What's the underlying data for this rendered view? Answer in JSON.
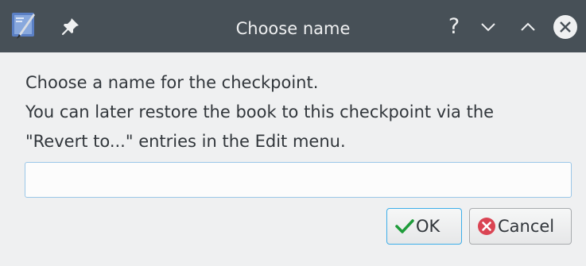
{
  "window": {
    "title": "Choose name",
    "help_label": "?"
  },
  "message": {
    "line1": "Choose a name for the checkpoint.",
    "line2": "You can later restore the book to this checkpoint via the",
    "line3": "\"Revert to...\" entries in the Edit menu."
  },
  "name_input": {
    "value": "",
    "placeholder": ""
  },
  "buttons": {
    "ok_label": "OK",
    "cancel_label": "Cancel"
  },
  "icons": {
    "app": "calibre-app-icon",
    "pin": "pin-icon",
    "minimize": "chevron-down-icon",
    "maximize": "chevron-up-icon",
    "close": "close-icon",
    "ok": "checkmark-icon",
    "cancel": "cancel-icon"
  },
  "colors": {
    "titlebar": "#475057",
    "ok_check": "#1e9c3a",
    "cancel_red": "#da4453",
    "focus_border": "#3daee9"
  }
}
